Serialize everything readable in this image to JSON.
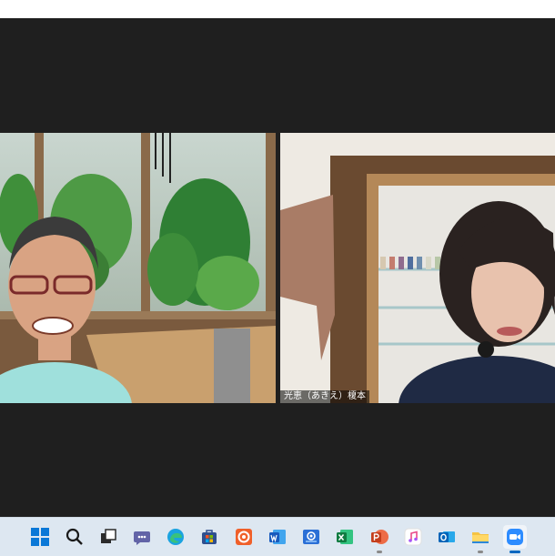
{
  "zoom": {
    "participants": [
      {
        "id": "left",
        "name": ""
      },
      {
        "id": "right",
        "name": "光恵（あきえ）榎本"
      }
    ]
  },
  "taskbar": {
    "icons": [
      "windows-start-icon",
      "search-icon",
      "task-view-icon",
      "teams-chat-icon",
      "edge-icon",
      "microsoft-store-icon",
      "avast-icon",
      "word-icon",
      "mail-icon",
      "excel-icon",
      "powerpoint-icon",
      "itunes-icon",
      "outlook-icon",
      "file-explorer-icon",
      "zoom-icon"
    ],
    "active": "zoom-icon",
    "colors": {
      "accent": "#0067c0",
      "background": "#dde7f1"
    }
  }
}
